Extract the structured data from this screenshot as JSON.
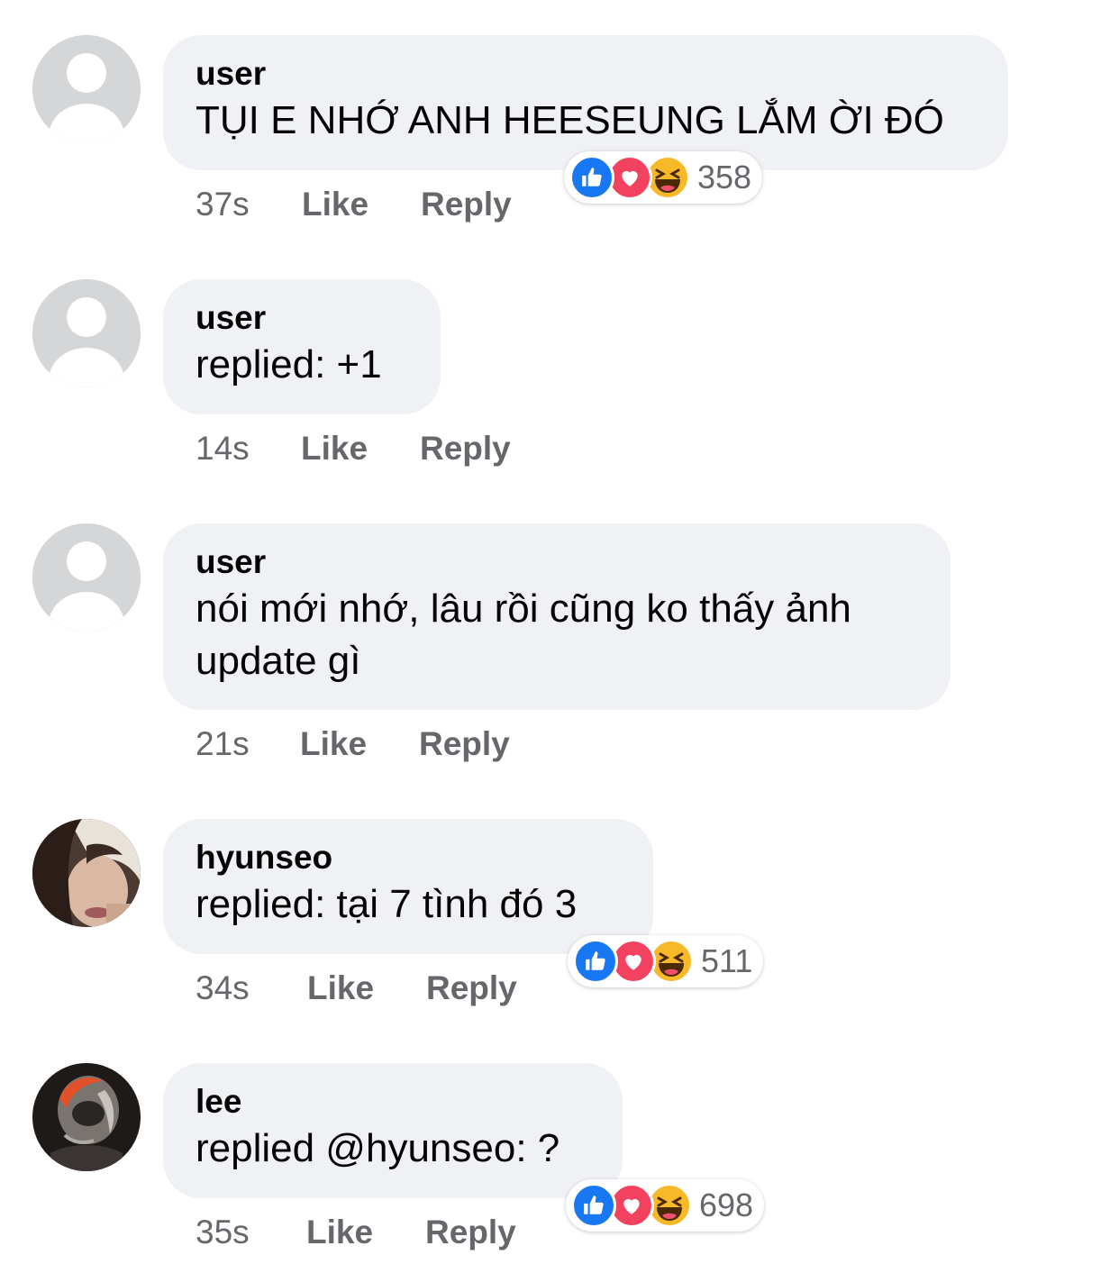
{
  "comments": [
    {
      "author": "user",
      "text": [
        "TỤI E NHỚ ANH HEESEUNG LẮM ỜI ĐÓ"
      ],
      "time": "37s",
      "like_label": "Like",
      "reply_label": "Reply",
      "reaction_count": "358",
      "avatar": "default-avatar"
    },
    {
      "author": "user",
      "text": [
        "replied: +1"
      ],
      "time": "14s",
      "like_label": "Like",
      "reply_label": "Reply",
      "avatar": "default-avatar"
    },
    {
      "author": "user",
      "text": [
        "nói mới nhớ, lâu rồi cũng ko thấy ảnh",
        "update gì"
      ],
      "time": "21s",
      "like_label": "Like",
      "reply_label": "Reply",
      "avatar": "default-avatar"
    },
    {
      "author": "hyunseo",
      "text": [
        "replied: tại 7 tình đó 3"
      ],
      "time": "34s",
      "like_label": "Like",
      "reply_label": "Reply",
      "reaction_count": "511",
      "avatar": "photo-avatar"
    },
    {
      "author": "lee",
      "text": [
        "replied @hyunseo: ?"
      ],
      "time": "35s",
      "like_label": "Like",
      "reply_label": "Reply",
      "reaction_count": "698",
      "avatar": "photo-avatar"
    }
  ],
  "reaction_icons": [
    "like-icon",
    "love-icon",
    "haha-icon"
  ],
  "colors": {
    "bubble": "#f0f1f5",
    "meta_text": "#65676b",
    "like_blue": "#1877f2",
    "love_red": "#f3425f",
    "haha_yellow": "#f7b928"
  }
}
